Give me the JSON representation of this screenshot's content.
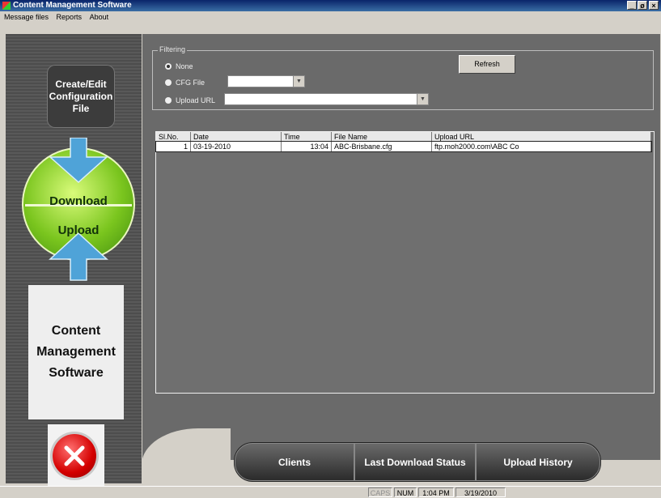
{
  "window": {
    "title": "Content Management Software",
    "controls": {
      "minimize": "_",
      "restore": "ø",
      "close": "×"
    }
  },
  "menu": {
    "items": [
      "Message files",
      "Reports",
      "About"
    ]
  },
  "sidebar": {
    "create_lines": [
      "Create/Edit",
      "Configuration",
      "File"
    ],
    "download": "Download",
    "upload": "Upload",
    "app_name_lines": [
      "Content",
      "Management",
      "Software"
    ],
    "exit_icon": "close-x-icon"
  },
  "filtering": {
    "legend": "Filtering",
    "options": [
      {
        "label": "None",
        "checked": true
      },
      {
        "label": "CFG File",
        "checked": false
      },
      {
        "label": "Upload URL",
        "checked": false
      }
    ],
    "cfg_file_value": "",
    "upload_url_value": "",
    "refresh_label": "Refresh"
  },
  "table": {
    "columns": [
      "Sl.No.",
      "Date",
      "Time",
      "File Name",
      "Upload URL"
    ],
    "rows": [
      [
        "1",
        "03-19-2010",
        "13:04",
        "ABC-Brisbane.cfg",
        "ftp.moh2000.com\\ABC Co"
      ]
    ]
  },
  "bottom_buttons": [
    "Clients",
    "Last Download Status",
    "Upload History"
  ],
  "statusbar": {
    "caps": "CAPS",
    "num": "NUM",
    "time": "1:04 PM",
    "date": "3/19/2010"
  },
  "colors": {
    "title_gradient_start": "#0a246a",
    "title_gradient_end": "#3a6ea5",
    "sphere_green": "#7ac51e",
    "arrow_blue": "#4fa3d8",
    "exit_red": "#d40000"
  }
}
